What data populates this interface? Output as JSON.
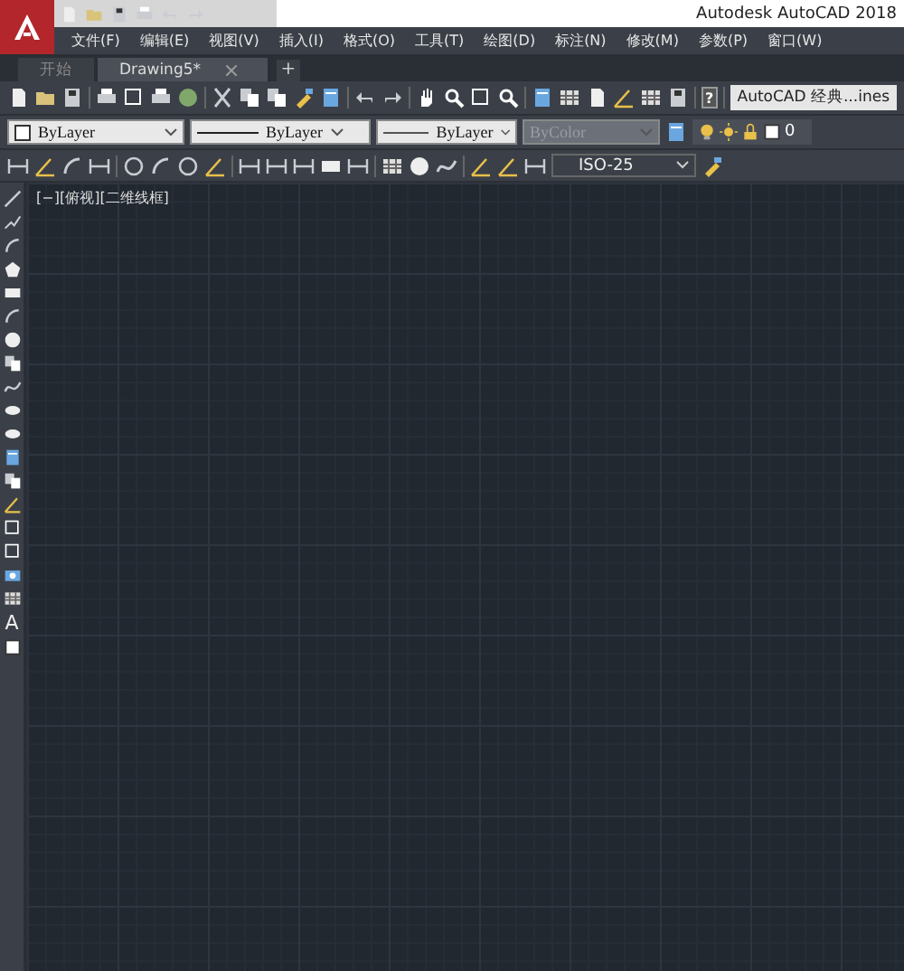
{
  "window": {
    "title": "Autodesk AutoCAD 2018"
  },
  "menu": [
    "文件(F)",
    "编辑(E)",
    "视图(V)",
    "插入(I)",
    "格式(O)",
    "工具(T)",
    "绘图(D)",
    "标注(N)",
    "修改(M)",
    "参数(P)",
    "窗口(W)"
  ],
  "tabs": [
    {
      "label": "开始",
      "selected": false,
      "closable": false
    },
    {
      "label": "Drawing5*",
      "selected": true,
      "closable": true
    }
  ],
  "new_tab": "+",
  "standard_toolbar": {
    "help": "?",
    "workspace": "AutoCAD 经典...ines"
  },
  "properties_toolbar": {
    "dropdowns": [
      {
        "kind": "color",
        "value": "ByLayer",
        "disabled": false
      },
      {
        "kind": "line",
        "value": "ByLayer",
        "disabled": false
      },
      {
        "kind": "line",
        "value": "ByLayer",
        "disabled": false
      },
      {
        "kind": "plain",
        "value": "ByColor",
        "disabled": true
      }
    ],
    "layer": "0"
  },
  "dimension_toolbar": {
    "style": "ISO-25"
  },
  "draw_toolbar": {
    "text_tool": "A"
  },
  "viewport": {
    "label": "[−][俯视][二维线框]"
  }
}
